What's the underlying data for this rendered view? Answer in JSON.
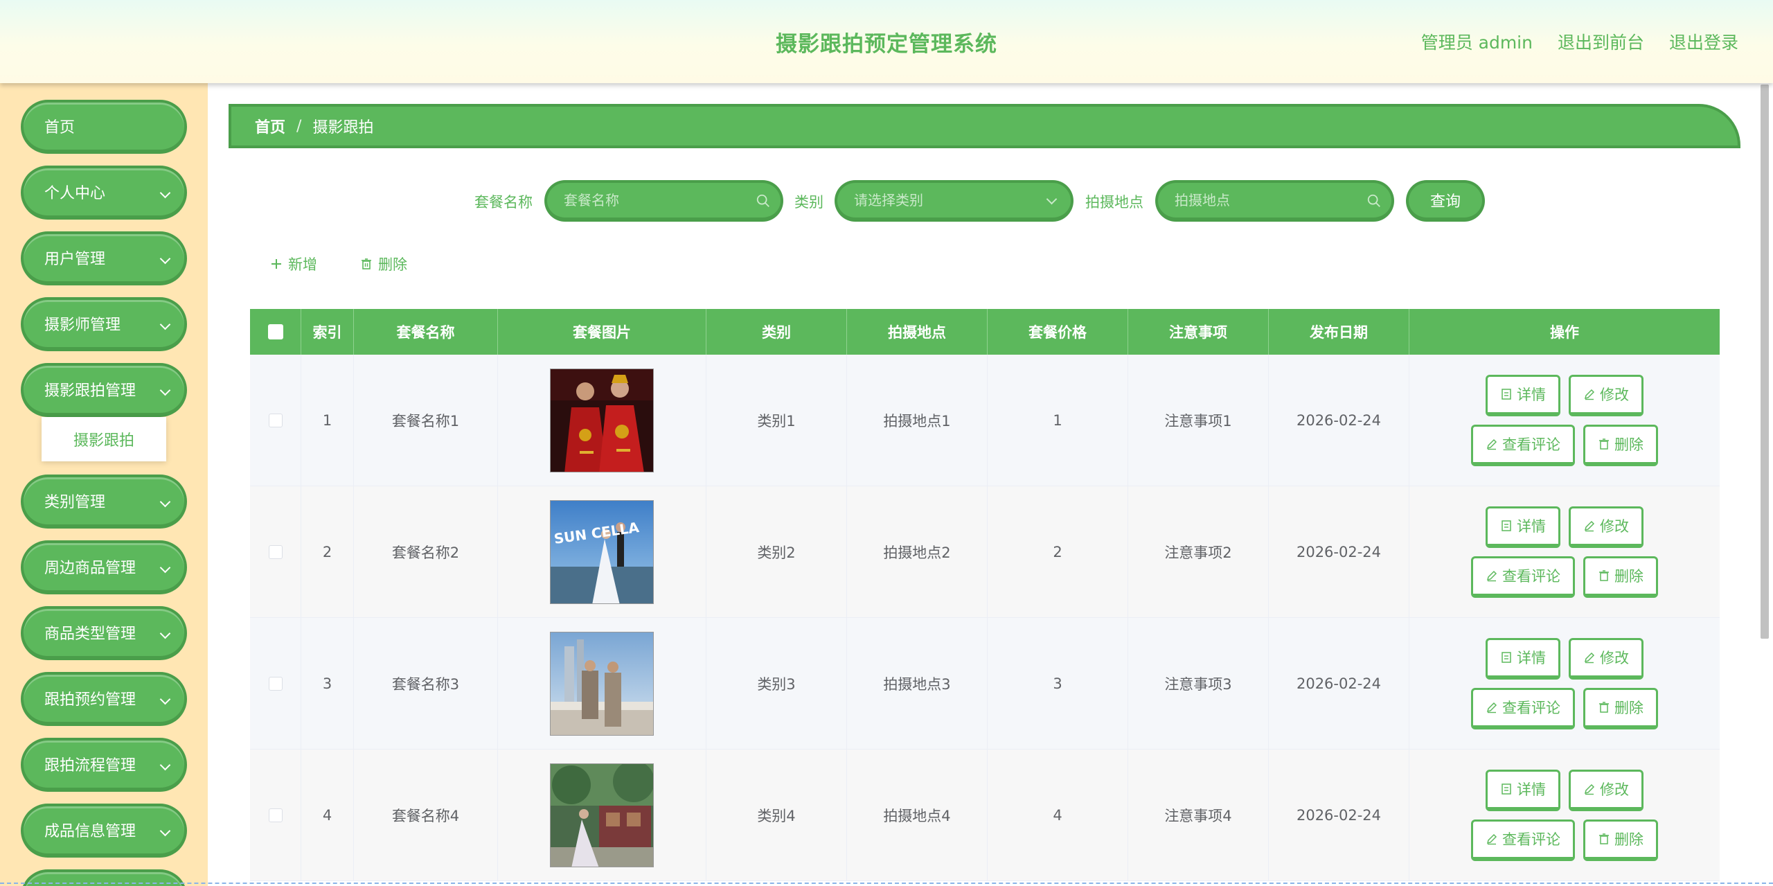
{
  "header": {
    "title": "摄影跟拍预定管理系统",
    "admin_label": "管理员 admin",
    "front_label": "退出到前台",
    "logout_label": "退出登录"
  },
  "sidebar": {
    "items": [
      {
        "label": "首页",
        "has_children": false
      },
      {
        "label": "个人中心",
        "has_children": true
      },
      {
        "label": "用户管理",
        "has_children": true
      },
      {
        "label": "摄影师管理",
        "has_children": true
      },
      {
        "label": "摄影跟拍管理",
        "has_children": true
      },
      {
        "label": "类别管理",
        "has_children": true
      },
      {
        "label": "周边商品管理",
        "has_children": true
      },
      {
        "label": "商品类型管理",
        "has_children": true
      },
      {
        "label": "跟拍预约管理",
        "has_children": true
      },
      {
        "label": "跟拍流程管理",
        "has_children": true
      },
      {
        "label": "成品信息管理",
        "has_children": true
      }
    ],
    "submenu_label": "摄影跟拍"
  },
  "breadcrumb": {
    "home": "首页",
    "sep": "/",
    "current": "摄影跟拍"
  },
  "search": {
    "name_label": "套餐名称",
    "name_placeholder": "套餐名称",
    "category_label": "类别",
    "category_placeholder": "请选择类别",
    "location_label": "拍摄地点",
    "location_placeholder": "拍摄地点",
    "query_label": "查询"
  },
  "actions": {
    "add_label": "新增",
    "delete_label": "删除"
  },
  "table": {
    "headers": [
      "索引",
      "套餐名称",
      "套餐图片",
      "类别",
      "拍摄地点",
      "套餐价格",
      "注意事项",
      "发布日期",
      "操作"
    ],
    "rows": [
      {
        "index": "1",
        "name": "套餐名称1",
        "category": "类别1",
        "location": "拍摄地点1",
        "price": "1",
        "notes": "注意事项1",
        "date": "2026-02-24"
      },
      {
        "index": "2",
        "name": "套餐名称2",
        "category": "类别2",
        "location": "拍摄地点2",
        "price": "2",
        "notes": "注意事项2",
        "date": "2026-02-24"
      },
      {
        "index": "3",
        "name": "套餐名称3",
        "category": "类别3",
        "location": "拍摄地点3",
        "price": "3",
        "notes": "注意事项3",
        "date": "2026-02-24"
      },
      {
        "index": "4",
        "name": "套餐名称4",
        "category": "类别4",
        "location": "拍摄地点4",
        "price": "4",
        "notes": "注意事项4",
        "date": "2026-02-24"
      }
    ],
    "ops": {
      "detail": "详情",
      "edit": "修改",
      "comments": "查看评论",
      "delete": "删除"
    },
    "photo_text_row2": "SUN CELLA"
  },
  "colors": {
    "accent": "#5cb85c",
    "accent_dark": "#4a9e4a",
    "sidebar_bg": "#ffe6b3"
  }
}
